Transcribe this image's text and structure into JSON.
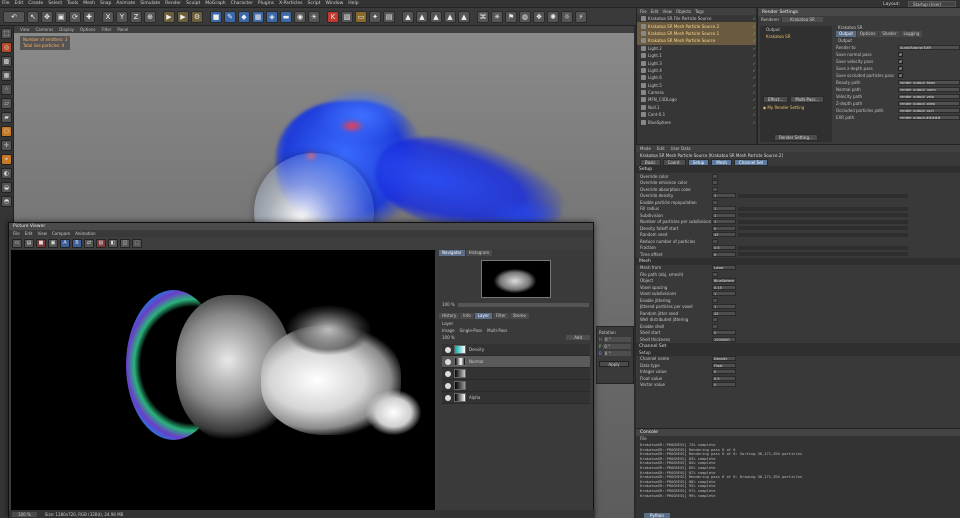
{
  "menubar": {
    "items": [
      "File",
      "Edit",
      "Create",
      "Select",
      "Tools",
      "Mesh",
      "Snap",
      "Animate",
      "Simulate",
      "Render",
      "Sculpt",
      "MoGraph",
      "Character",
      "Plugins",
      "X-Particles",
      "Script",
      "Window",
      "Help"
    ],
    "layout_label": "Layout:",
    "layout_value": "Startup (User)"
  },
  "viewport": {
    "menu": [
      "View",
      "Cameras",
      "Display",
      "Options",
      "Filter",
      "Panel"
    ],
    "hud_line1": "Number of emitters: 3",
    "hud_line2": "Total live particles: 0"
  },
  "picture_viewer": {
    "title": "Picture Viewer",
    "menu": [
      "File",
      "Edit",
      "View",
      "Compare",
      "Animation"
    ],
    "status_zoom": "100 %",
    "status_info": "Size: 1280x720, RGB (32Bit), 24.98 MB",
    "side_tabs": [
      "Navigator",
      "Histogram"
    ],
    "zoom_value": "100 %",
    "layer_tabs": [
      "History",
      "Info",
      "Layer",
      "Filter",
      "Stereo"
    ],
    "layer_label": "Layer",
    "layer_modes": [
      "Image",
      "Single-Pass",
      "Multi-Pass"
    ],
    "layer_zoom": "100 %",
    "layer_blend": "Add",
    "layers": [
      "Density",
      "Normal",
      "",
      "",
      "Alpha"
    ]
  },
  "object_manager": {
    "menu": [
      "File",
      "Edit",
      "View",
      "Objects",
      "Tags"
    ],
    "objects": [
      "Krakatoa SR File Particle Source",
      "Krakatoa SR Mesh Particle Source.2",
      "Krakatoa SR Mesh Particle Source.1",
      "Krakatoa SR Mesh Particle Source",
      "Light.2",
      "Light.1",
      "Light.3",
      "Light.4",
      "Light.6",
      "Light.5",
      "Camera",
      "MFN_C4DLogo",
      "Null.1",
      "Cont-0.1",
      "BlueSphere"
    ]
  },
  "render_settings": {
    "title": "Render Settings",
    "renderer_label": "Renderer",
    "renderer_value": "Krakatoa SR",
    "tree": [
      "Output",
      "Krakatoa SR"
    ],
    "effect_button": "Effect...",
    "multipass_button": "Multi-Pass...",
    "my_render_setting": "My Render Setting",
    "bottom_button": "Render Setting...",
    "panel_title": "Krakatoa SR",
    "tabs": [
      "Output",
      "Options",
      "Shader",
      "Logging"
    ],
    "section": "Output",
    "fields": [
      {
        "label": "Render to",
        "value": "AudioTutorial EXR"
      },
      {
        "label": "Save normal pass",
        "value": ""
      },
      {
        "label": "Save velocity pass",
        "value": ""
      },
      {
        "label": "Save z-depth pass",
        "value": ""
      },
      {
        "label": "Save occluded particles pass",
        "value": ""
      },
      {
        "label": "Beauty path",
        "value": "render_output_beau"
      },
      {
        "label": "Normal path",
        "value": "render_output_norm"
      },
      {
        "label": "Velocity path",
        "value": "render_output_velo"
      },
      {
        "label": "Z-depth path",
        "value": "render_output_zdep"
      },
      {
        "label": "Occluded particles path",
        "value": "render_output_occl"
      },
      {
        "label": "EXR path",
        "value": "render_output.#####"
      }
    ]
  },
  "attributes": {
    "menu": [
      "Mode",
      "Edit",
      "User Data"
    ],
    "header": "Krakatoa SR Mesh Particle Source [Krakatoa SR Mesh Particle Source.2]",
    "tab_buttons": [
      "Basic",
      "Coord.",
      "Setup",
      "Mesh",
      "Channel Set"
    ],
    "setup_section": "Setup",
    "setup_rows": [
      {
        "label": "Override color",
        "value": ""
      },
      {
        "label": "Override emission color",
        "value": ""
      },
      {
        "label": "Override absorption color",
        "value": ""
      },
      {
        "label": "Override density",
        "value": "1"
      },
      {
        "label": "Enable particle repopulation",
        "value": ""
      },
      {
        "label": "Fill radius",
        "value": "1"
      },
      {
        "label": "Subdivision",
        "value": "1"
      },
      {
        "label": "Number of particles per subdivision",
        "value": "1"
      },
      {
        "label": "Density falloff start",
        "value": "0"
      },
      {
        "label": "Random seed",
        "value": "42"
      },
      {
        "label": "Reduce number of particles",
        "value": ""
      },
      {
        "label": "Fraction",
        "value": "0.5"
      },
      {
        "label": "Time offset",
        "value": "0"
      }
    ],
    "mesh_section": "Mesh",
    "mesh_rows": [
      {
        "label": "Mesh from",
        "value": "Layer"
      },
      {
        "label": "File path (obj, xmesh)",
        "value": ""
      },
      {
        "label": "Object",
        "value": "BlueSphere"
      },
      {
        "label": "Voxel spacing",
        "value": "0.15"
      },
      {
        "label": "Voxel subdivisions",
        "value": "1"
      },
      {
        "label": "Enable jittering",
        "value": ""
      },
      {
        "label": "Jittered particles per voxel",
        "value": "1"
      },
      {
        "label": "Random jitter seed",
        "value": "42"
      },
      {
        "label": "Well distributed jittering",
        "value": ""
      },
      {
        "label": "Enable shell",
        "value": ""
      },
      {
        "label": "Shell start",
        "value": "0"
      },
      {
        "label": "Shell thickness",
        "value": "1000000"
      }
    ],
    "channel_section": "Channel Set",
    "channel_sub": "Setup",
    "channel_rows": [
      {
        "label": "Channel name",
        "value": "Density"
      },
      {
        "label": "Data type",
        "value": "Float"
      },
      {
        "label": "Integer value",
        "value": "0"
      },
      {
        "label": "Float value",
        "value": "0.5"
      },
      {
        "label": "Vector value",
        "value": "0"
      }
    ]
  },
  "coords_panel": {
    "title": "Rotation",
    "rows": [
      "0 °",
      "0 °",
      "0 °"
    ],
    "apply": "Apply"
  },
  "console": {
    "title": "Console",
    "menu": "File",
    "lines": [
      "KrakatoaSR::PROGRESS] 74% complete",
      "KrakatoaSR::PROGRESS] Rendering pass 6 of 6",
      "KrakatoaSR::PROGRESS] Rendering pass 6 of 6: Sorting 36,171,394 particles",
      "KrakatoaSR::PROGRESS] 83% complete",
      "KrakatoaSR::PROGRESS] 84% complete",
      "KrakatoaSR::PROGRESS] 85% complete",
      "KrakatoaSR::PROGRESS] 87% complete",
      "KrakatoaSR::PROGRESS] Rendering pass 6 of 6: Drawing 36,171,394 particles",
      "KrakatoaSR::PROGRESS] 88% complete",
      "KrakatoaSR::PROGRESS] 95% complete",
      "KrakatoaSR::PROGRESS] 97% complete",
      "KrakatoaSR::PROGRESS] 99% complete"
    ],
    "tab": "Python"
  }
}
